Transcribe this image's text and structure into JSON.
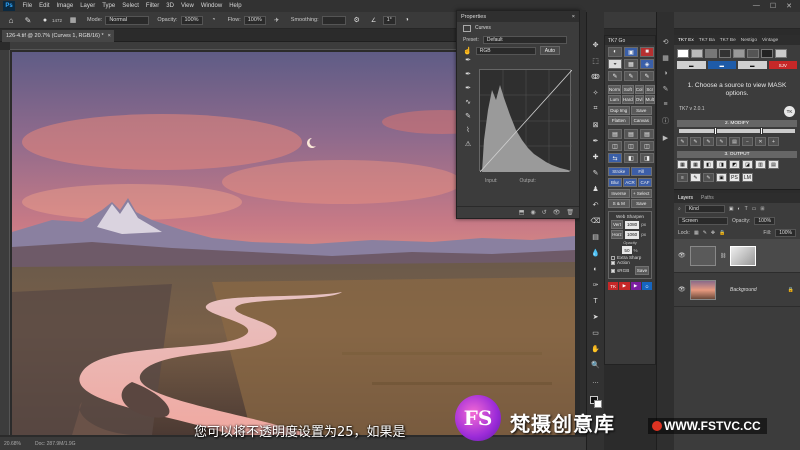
{
  "app": {
    "logo": "Ps"
  },
  "menu": [
    "File",
    "Edit",
    "Image",
    "Layer",
    "Type",
    "Select",
    "Filter",
    "3D",
    "View",
    "Window",
    "Help"
  ],
  "window_controls": [
    "—",
    "☐",
    "✕"
  ],
  "options_bar": {
    "brush_size": "1472",
    "mode_label": "Mode:",
    "mode_value": "Normal",
    "opacity_label": "Opacity:",
    "opacity_value": "100%",
    "flow_label": "Flow:",
    "flow_value": "100%",
    "smoothing_label": "Smoothing:",
    "smoothing_value": "",
    "angle_value": "1°"
  },
  "document": {
    "tab_title": "126-4.tif @ 20.7% (Curves 1, RGB/16) *",
    "tab_close": "×",
    "zoom": "20.68%",
    "doc_info": "Doc: 287.9M/1.9G"
  },
  "properties": {
    "title": "Properties",
    "close": "×",
    "adjustment_name": "Curves",
    "preset_label": "Preset:",
    "preset_value": "Default",
    "channel_value": "RGB",
    "auto_label": "Auto",
    "input_label": "Input:",
    "output_label": "Output:"
  },
  "tk7_go": {
    "title": "TK7 Go",
    "buttons": {
      "norm": "Norm",
      "soft": "Soft",
      "col": "Col",
      "scr": "Scr",
      "lum": "Lum",
      "hard": "Hard",
      "ovl": "Ovl",
      "mult": "Mult",
      "dup": "Dup Img",
      "save": "Save",
      "flatten": "Flatten",
      "canvas": "Canvas",
      "stroke": "Stroke",
      "fill": "Fill",
      "blur": "Blur",
      "acr": "ACR",
      "cam": "CAF",
      "inverse": "Inverse",
      "sel": "+ Select",
      "sm": "S & M",
      "save2": "Save",
      "sharpen_title": "Web Sharpen",
      "vert": "Vert",
      "vert_value": "1080",
      "px1": "px",
      "horz": "Horz",
      "horz_value": "1060",
      "px2": "px",
      "opacity_label": "Opacity",
      "opacity_value": "50",
      "pct": "%",
      "extra_sharp": "Extra Sharp",
      "action": "Action",
      "srgb": "sRGB",
      "save3": "Save",
      "tk": "TK"
    }
  },
  "tk7_ex": {
    "tabs": [
      "TK7 Ex",
      "TK7 Ba",
      "TK7 Be",
      "Nestigo",
      "Vintage"
    ],
    "sjv": "SJV",
    "message": "1. Choose a source to view MASK options.",
    "version": "TK7 v 2.0.1",
    "version_logo": "TK",
    "modify_label": "2. MODIFY",
    "output_label": "3. OUTPUT",
    "ps_label": "PS",
    "lm_label": "LM"
  },
  "layers": {
    "tabs": [
      "Layers",
      "Paths"
    ],
    "kind_label": "Kind",
    "blend_mode": "Screen",
    "opacity_label": "Opacity:",
    "opacity_value": "100%",
    "lock_label": "Lock:",
    "fill_label": "Fill:",
    "fill_value": "100%",
    "items": [
      {
        "name": ""
      },
      {
        "name": "Background"
      }
    ]
  },
  "overlay": {
    "subtitle": "您可以将不透明度设置为25，如果是",
    "watermark_logo": "FS",
    "watermark_text": "梵摄创意库",
    "watermark_url": "WWW.FSTVC.CC"
  },
  "colors": {
    "panel_bg": "#3c3c3c",
    "menu_bg": "#323232",
    "accent_blue": "#3c5ea8",
    "watermark_purple": "#9b2bd8"
  }
}
